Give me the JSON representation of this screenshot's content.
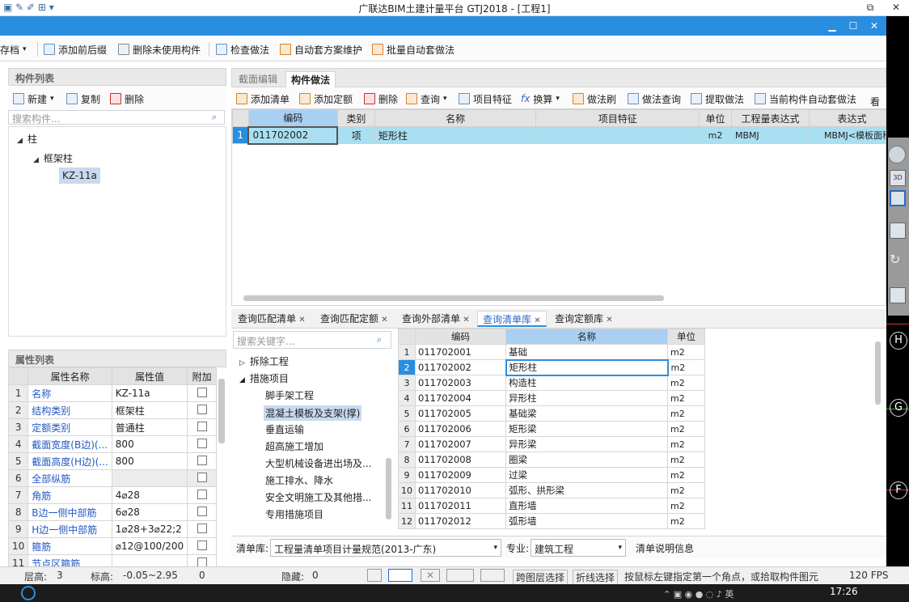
{
  "app": {
    "title": "广联达BIM土建计量平台 GTJ2018 - [工程1]"
  },
  "toolbar1": {
    "items": [
      "存档",
      "添加前后缀",
      "删除未使用构件",
      "检查做法",
      "自动套方案维护",
      "批量自动套做法"
    ]
  },
  "component_list": {
    "header": "构件列表",
    "new_label": "新建",
    "copy_label": "复制",
    "delete_label": "删除",
    "search_placeholder": "搜索构件...",
    "tree": [
      "柱",
      "框架柱",
      "KZ-11a"
    ]
  },
  "properties": {
    "header": "属性列表",
    "columns": [
      "属性名称",
      "属性值",
      "附加"
    ],
    "rows": [
      {
        "no": "1",
        "name": "名称",
        "value": "KZ-11a"
      },
      {
        "no": "2",
        "name": "结构类别",
        "value": "框架柱"
      },
      {
        "no": "3",
        "name": "定额类别",
        "value": "普通柱"
      },
      {
        "no": "4",
        "name": "截面宽度(B边)(...",
        "value": "800"
      },
      {
        "no": "5",
        "name": "截面高度(H边)(...",
        "value": "800"
      },
      {
        "no": "6",
        "name": "全部纵筋",
        "value": ""
      },
      {
        "no": "7",
        "name": "角筋",
        "value": "4⌀28"
      },
      {
        "no": "8",
        "name": "B边一侧中部筋",
        "value": "6⌀28"
      },
      {
        "no": "9",
        "name": "H边一侧中部筋",
        "value": "1⌀28+3⌀22;2"
      },
      {
        "no": "10",
        "name": "箍筋",
        "value": "⌀12@100/200"
      },
      {
        "no": "11",
        "name": "节点区箍筋",
        "value": ""
      }
    ]
  },
  "tabs_top": [
    "截面编辑",
    "构件做法"
  ],
  "toolbar2": {
    "items": [
      "添加清单",
      "添加定额",
      "删除",
      "查询",
      "项目特征",
      "换算",
      "做法刷",
      "做法查询",
      "提取做法",
      "当前构件自动套做法"
    ],
    "overflow": "看"
  },
  "method_grid": {
    "columns": [
      "编码",
      "类别",
      "名称",
      "项目特征",
      "单位",
      "工程量表达式",
      "表达式"
    ],
    "rows": [
      {
        "no": "1",
        "code": "011702002",
        "type": "项",
        "name": "矩形柱",
        "feature": "",
        "unit": "m2",
        "expr": "MBMJ",
        "expr2": "MBMJ<模板面积"
      }
    ]
  },
  "bottom_tabs": [
    "查询匹配清单",
    "查询匹配定额",
    "查询外部清单",
    "查询清单库",
    "查询定额库"
  ],
  "library": {
    "search_placeholder": "搜索关键字...",
    "tree": [
      "拆除工程",
      "措施项目",
      "脚手架工程",
      "混凝土模板及支架(撑)",
      "垂直运输",
      "超高施工增加",
      "大型机械设备进出场及...",
      "施工排水、降水",
      "安全文明施工及其他措...",
      "专用措施项目"
    ],
    "columns": [
      "编码",
      "名称",
      "单位"
    ],
    "rows": [
      {
        "no": "1",
        "code": "011702001",
        "name": "基础",
        "unit": "m2"
      },
      {
        "no": "2",
        "code": "011702002",
        "name": "矩形柱",
        "unit": "m2"
      },
      {
        "no": "3",
        "code": "011702003",
        "name": "构造柱",
        "unit": "m2"
      },
      {
        "no": "4",
        "code": "011702004",
        "name": "异形柱",
        "unit": "m2"
      },
      {
        "no": "5",
        "code": "011702005",
        "name": "基础梁",
        "unit": "m2"
      },
      {
        "no": "6",
        "code": "011702006",
        "name": "矩形梁",
        "unit": "m2"
      },
      {
        "no": "7",
        "code": "011702007",
        "name": "异形梁",
        "unit": "m2"
      },
      {
        "no": "8",
        "code": "011702008",
        "name": "圈梁",
        "unit": "m2"
      },
      {
        "no": "9",
        "code": "011702009",
        "name": "过梁",
        "unit": "m2"
      },
      {
        "no": "10",
        "code": "011702010",
        "name": "弧形、拱形梁",
        "unit": "m2"
      },
      {
        "no": "11",
        "code": "011702011",
        "name": "直形墙",
        "unit": "m2"
      },
      {
        "no": "12",
        "code": "011702012",
        "name": "弧形墙",
        "unit": "m2"
      }
    ],
    "bill_label": "清单库:",
    "bill_value": "工程量清单项目计量规范(2013-广东)",
    "major_label": "专业:",
    "major_value": "建筑工程",
    "info_label": "清单说明信息"
  },
  "status": {
    "floor_label": "层高:",
    "floor_value": "3",
    "elev_label": "标高:",
    "elev_value": "-0.05~2.95",
    "zero": "0",
    "hide_label": "隐藏:",
    "hide_value": "0",
    "cross_layer": "跨图层选择",
    "polyline": "折线选择",
    "hint": "按鼠标左键指定第一个角点，或拾取构件图元",
    "fps": "120 FPS"
  },
  "taskbar": {
    "time": "17:26"
  },
  "side_axis": [
    "H",
    "G",
    "F"
  ]
}
